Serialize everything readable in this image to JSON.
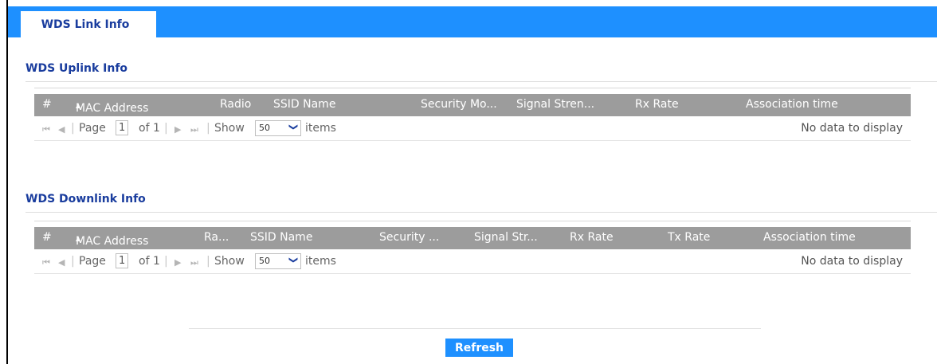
{
  "tab": {
    "label": "WDS Link Info"
  },
  "uplink": {
    "title": "WDS Uplink Info",
    "columns": [
      "#",
      "MAC Address",
      "Radio",
      "SSID Name",
      "Security Mo...",
      "Signal Stren...",
      "Rx Rate",
      "Association time"
    ],
    "pager": {
      "page_label": "Page",
      "page_value": "1",
      "of_label": "of 1",
      "show_label": "Show",
      "show_value": "50",
      "items_label": "items",
      "empty_text": "No data to display"
    }
  },
  "downlink": {
    "title": "WDS Downlink Info",
    "columns": [
      "#",
      "MAC Address",
      "Ra...",
      "SSID Name",
      "Security ...",
      "Signal Str...",
      "Rx Rate",
      "Tx Rate",
      "Association time"
    ],
    "pager": {
      "page_label": "Page",
      "page_value": "1",
      "of_label": "of 1",
      "show_label": "Show",
      "show_value": "50",
      "items_label": "items",
      "empty_text": "No data to display"
    }
  },
  "actions": {
    "refresh_label": "Refresh"
  },
  "colors": {
    "accent": "#1e90ff",
    "heading": "#1a3d9e",
    "table_header": "#9c9c9c"
  },
  "icons": [
    "first-page-icon",
    "prev-page-icon",
    "next-page-icon",
    "last-page-icon",
    "sort-asc-icon",
    "chevron-down-icon"
  ]
}
